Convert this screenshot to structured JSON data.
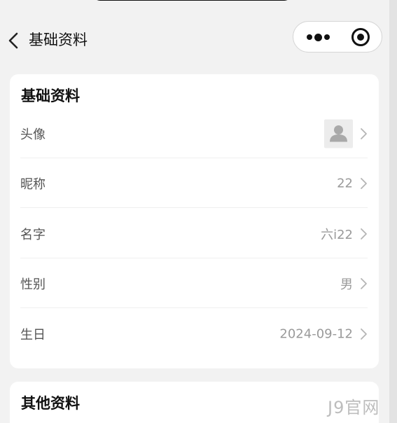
{
  "navbar": {
    "title": "基础资料",
    "back_icon": "chevron-left-icon",
    "more_icon": "more-dots-icon",
    "close_icon": "target-circle-icon"
  },
  "basic_card": {
    "title": "基础资料",
    "rows": [
      {
        "label": "头像",
        "value": "",
        "type": "avatar",
        "avatar_icon": "user-placeholder-icon"
      },
      {
        "label": "昵称",
        "value": "22"
      },
      {
        "label": "名字",
        "value": "六i22"
      },
      {
        "label": "性别",
        "value": "男"
      },
      {
        "label": "生日",
        "value": "2024-09-12"
      }
    ]
  },
  "other_card": {
    "title": "其他资料"
  },
  "watermark": "J9官网",
  "colors": {
    "background": "#f2f2f2",
    "card": "#ffffff",
    "label": "#555555",
    "value": "#9a9a9a",
    "separator": "#efefef"
  }
}
